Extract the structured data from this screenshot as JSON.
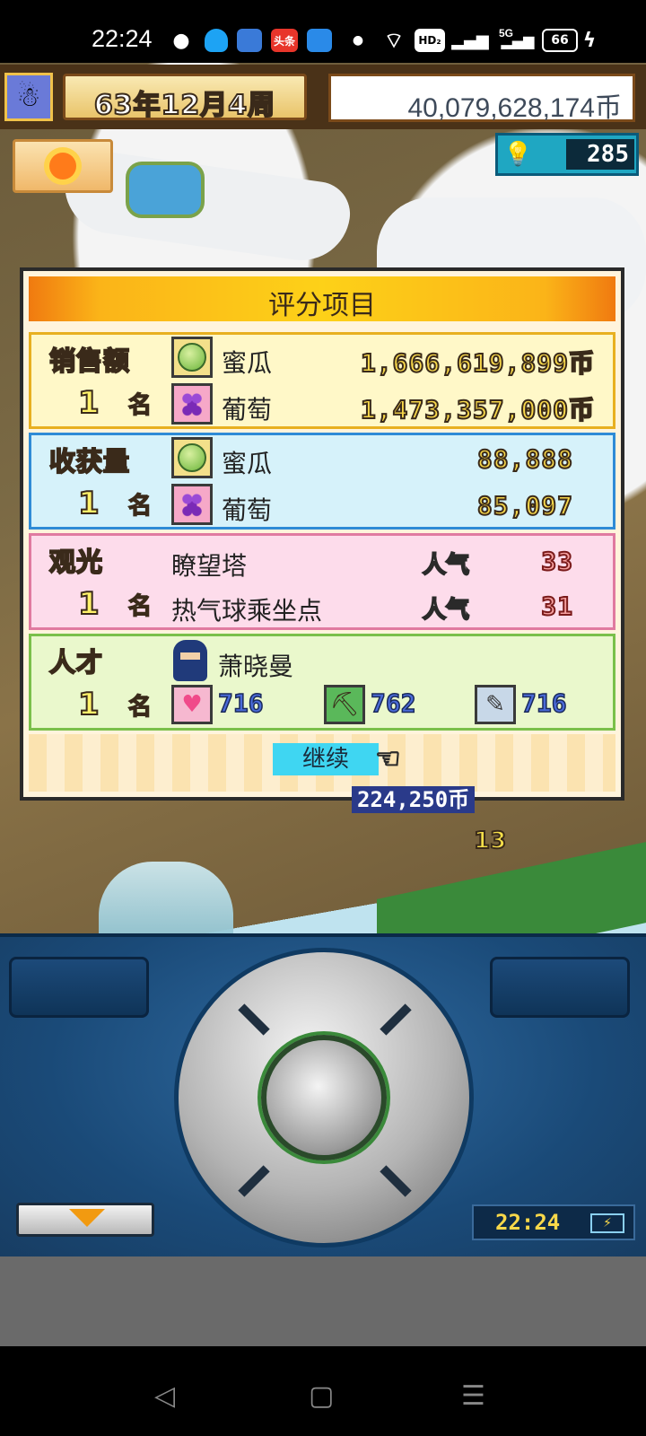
{
  "status_bar": {
    "time": "22:24",
    "icons": [
      "wechat-icon",
      "qq-icon",
      "app-icon",
      "toutiao-icon",
      "app2-icon",
      "dot-icon",
      "wifi-icon",
      "hd-icon",
      "signal-icon",
      "5g-signal-icon",
      "battery-icon",
      "charging-icon"
    ],
    "toutiao_label": "头条",
    "hd_label": "HD₂",
    "network_label": "5G",
    "battery_level": "66"
  },
  "hud": {
    "date": "63年12月4周",
    "money": "40,079,628,174币",
    "ideas": "285"
  },
  "dialog": {
    "title": "评分项目",
    "sales": {
      "category": "销售额",
      "rank": "1",
      "rank_unit": "名",
      "items": [
        {
          "icon": "melon-icon",
          "name": "蜜瓜",
          "value": "1,666,619,899币"
        },
        {
          "icon": "grape-icon",
          "name": "葡萄",
          "value": "1,473,357,000币"
        }
      ]
    },
    "harvest": {
      "category": "收获量",
      "rank": "1",
      "rank_unit": "名",
      "items": [
        {
          "icon": "melon-icon",
          "name": "蜜瓜",
          "value": "88,888"
        },
        {
          "icon": "grape-icon",
          "name": "葡萄",
          "value": "85,097"
        }
      ]
    },
    "tourism": {
      "category": "观光",
      "rank": "1",
      "rank_unit": "名",
      "items": [
        {
          "name": "瞭望塔",
          "label": "人气",
          "value": "33"
        },
        {
          "name": "热气球乘坐点",
          "label": "人气",
          "value": "31"
        }
      ]
    },
    "talent": {
      "category": "人才",
      "rank": "1",
      "rank_unit": "名",
      "name": "萧晓曼",
      "stats": [
        {
          "icon": "heart-icon",
          "value": "716"
        },
        {
          "icon": "hoe-icon",
          "value": "762"
        },
        {
          "icon": "book-icon",
          "value": "716"
        }
      ]
    },
    "continue_label": "继续"
  },
  "scene": {
    "floating_money": "224,250币",
    "floating_number": "13"
  },
  "controller": {
    "clock": "22:24"
  },
  "colors": {
    "dialog_bg": "#fff4dc",
    "sales": "#fff8c8",
    "harvest": "#d6f2fa",
    "tourism": "#fddceb",
    "talent": "#eaf8cc",
    "continue_button": "#3fd6f2"
  }
}
